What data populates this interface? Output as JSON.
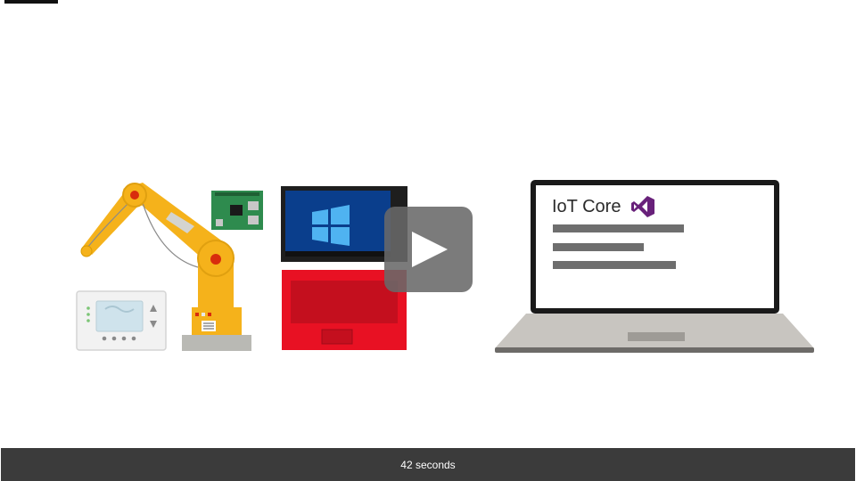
{
  "laptop_screen": {
    "title": "IoT Core",
    "logo_icon": "visual-studio-icon",
    "logo_color": "#68217a"
  },
  "video": {
    "play_icon": "play-icon",
    "duration_label": "42 seconds"
  },
  "colors": {
    "robot_arm": "#f5b21b",
    "joint": "#d82c0d",
    "tablet_keyboard": "#e81123",
    "footer": "#3b3b3b",
    "board": "#2e8b4e"
  }
}
